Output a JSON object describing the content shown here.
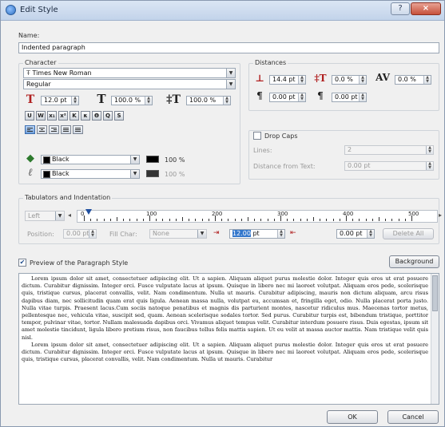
{
  "window": {
    "title": "Edit Style",
    "help_label": "?",
    "close_label": "×"
  },
  "name": {
    "label": "Name:",
    "value": "Indented paragraph"
  },
  "character": {
    "title": "Character",
    "font_family": "Times New Roman",
    "font_style": "Regular",
    "font_size": "12.0 pt",
    "scale_width": "100.0 %",
    "scale_height": "100.0 %",
    "format_buttons": [
      "U",
      "W",
      "x₁",
      "x²",
      "K",
      "κ",
      "Ө",
      "Q",
      "S"
    ],
    "fill_color": "Black",
    "fill_shade": "100 %",
    "stroke_color": "Black",
    "stroke_shade": "100 %",
    "accent_color": "#b02020"
  },
  "distances": {
    "title": "Distances",
    "line_spacing": "14.4 pt",
    "baseline_offset": "0.0 %",
    "tracking": "0.0 %",
    "space_before": "0.00 pt",
    "space_after": "0.00 pt"
  },
  "drop_caps": {
    "label": "Drop Caps",
    "checked": false,
    "lines_label": "Lines:",
    "lines_value": "2",
    "distance_label": "Distance from Text:",
    "distance_value": "0.00 pt"
  },
  "tabulators": {
    "title": "Tabulators and Indentation",
    "alignment": "Left",
    "ruler_labels": [
      "0",
      "100",
      "200",
      "300",
      "400",
      "500"
    ],
    "position_label": "Position:",
    "position_value": "0.00 pt",
    "fill_char_label": "Fill Char:",
    "fill_char_value": "None",
    "left_indent_value": "12.00",
    "left_indent_unit": "pt",
    "right_indent_value": "0.00 pt",
    "delete_all_label": "Delete All"
  },
  "preview": {
    "checkbox_label": "Preview of the Paragraph Style",
    "checked": true,
    "background_label": "Background",
    "text": "Lorem ipsum dolor sit amet, consectetuer adipiscing elit. Ut a sapien. Aliquam aliquet purus molestie dolor. Integer quis eros ut erat posuere dictum. Curabitur dignissim. Integer orci. Fusce vulputate lacus at ipsum. Quisque in libero nec mi laoreet volutpat. Aliquam eros pede, scelerisque quis, tristique cursus, placerat convallis, velit. Nam condimentum. Nulla ut mauris. Curabitur adipiscing, mauris non dictum aliquam, arcu risus dapibus diam, nec sollicitudin quam erat quis ligula. Aenean massa nulla, volutpat eu, accumsan et, fringilla eget, odio. Nulla placerat porta justo. Nulla vitae turpis. Praesent lacus.Cum sociis natoque penatibus et magnis dis parturient montes, nascetur ridiculus mus. Maecenas tortor metus, pellentesque nec, vehicula vitae, suscipit sed, quam. Aenean scelerisque sodales tortor. Sed purus. Curabitur turpis est, bibendum tristique, porttitor tempor, pulvinar vitae, tortor. Nullam malesuada dapibus orci. Vivamus aliquet tempus velit. Curabitur interdum posuere risus. Duis egestas, ipsum sit amet molestie tincidunt, ligula libero pretium risus, non faucibus tellus felis mattis sapien. Ut eu velit at massa auctor mattis. Nam tristique velit quis nisl.",
    "text2": "Lorem ipsum dolor sit amet, consectetuer adipiscing elit. Ut a sapien. Aliquam aliquet purus molestie dolor. Integer quis eros ut erat posuere dictum. Curabitur dignissim. Integer orci. Fusce vulputate lacus at ipsum. Quisque in libero nec mi laoreet volutpat. Aliquam eros pede, scelerisque quis, tristique cursus, placerat convallis, velit. Nam condimentum. Nulla ut mauris. Curabitur"
  },
  "footer": {
    "ok_label": "OK",
    "cancel_label": "Cancel"
  }
}
